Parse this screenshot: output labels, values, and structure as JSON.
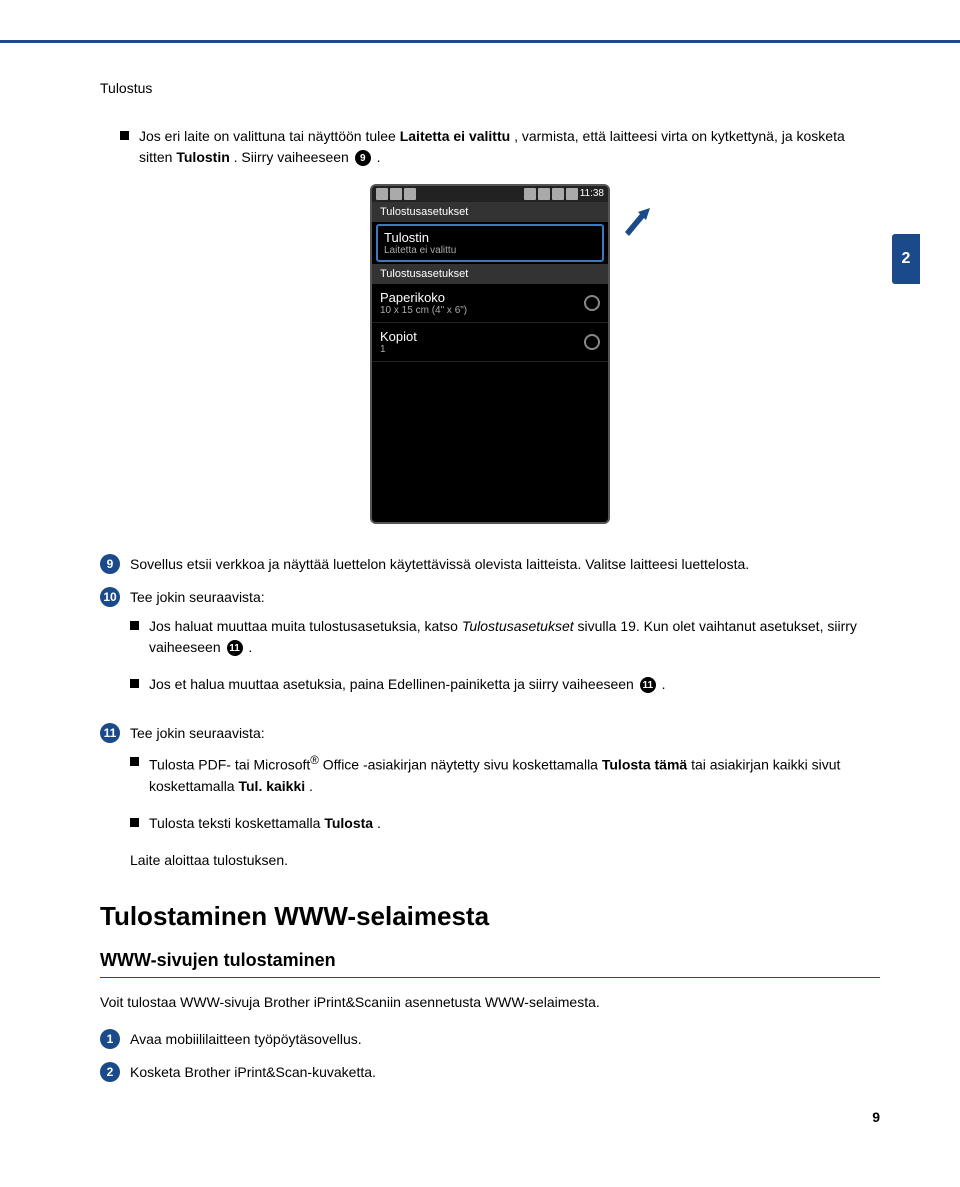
{
  "header": {
    "section": "Tulostus"
  },
  "chapter_tab": "2",
  "top_bullet": {
    "prefix": "Jos eri laite on valittuna tai näyttöön tulee ",
    "bold1": "Laitetta ei valittu",
    "mid1": ", varmista, että laitteesi virta on kytkettynä, ja kosketa sitten ",
    "bold2": "Tulostin",
    "mid2": ". Siirry vaiheeseen ",
    "step_ref": "9",
    "suffix": "."
  },
  "phone": {
    "time": "11:38",
    "screen_title": "Tulostusasetukset",
    "row_highlight": {
      "main": "Tulostin",
      "sub": "Laitetta ei valittu"
    },
    "section_title": "Tulostusasetukset",
    "row_paper": {
      "main": "Paperikoko",
      "sub": "10 x 15 cm (4\" x 6\")"
    },
    "row_copies": {
      "main": "Kopiot",
      "sub": "1"
    }
  },
  "steps": {
    "s9": {
      "num": "9",
      "text": "Sovellus etsii verkkoa ja näyttää luettelon käytettävissä olevista laitteista. Valitse laitteesi luettelosta."
    },
    "s10": {
      "num": "10",
      "intro": "Tee jokin seuraavista:",
      "b1": {
        "pre": "Jos haluat muuttaa muita tulostusasetuksia, katso ",
        "ital": "Tulostusasetukset",
        "mid": " sivulla 19. Kun olet vaihtanut asetukset, siirry vaiheeseen ",
        "ref": "11",
        "post": "."
      },
      "b2": {
        "pre": "Jos et halua muuttaa asetuksia, paina Edellinen-painiketta ja siirry vaiheeseen ",
        "ref": "11",
        "post": "."
      }
    },
    "s11": {
      "num": "11",
      "intro": "Tee jokin seuraavista:",
      "b1": {
        "pre": "Tulosta PDF- tai Microsoft",
        "sup": "®",
        "mid": " Office -asiakirjan näytetty sivu koskettamalla ",
        "bold1": "Tulosta tämä",
        "mid2": " tai asiakirjan kaikki sivut koskettamalla ",
        "bold2": "Tul. kaikki",
        "post": "."
      },
      "b2": {
        "pre": "Tulosta teksti koskettamalla ",
        "bold1": "Tulosta",
        "post": "."
      },
      "outro": "Laite aloittaa tulostuksen."
    }
  },
  "browser": {
    "h2": "Tulostaminen WWW-selaimesta",
    "h3": "WWW-sivujen tulostaminen",
    "intro": "Voit tulostaa WWW-sivuja Brother iPrint&Scaniin asennetusta WWW-selaimesta.",
    "step1": {
      "num": "1",
      "text": "Avaa mobiililaitteen työpöytäsovellus."
    },
    "step2": {
      "num": "2",
      "text": "Kosketa Brother iPrint&Scan-kuvaketta."
    }
  },
  "page_number": "9"
}
